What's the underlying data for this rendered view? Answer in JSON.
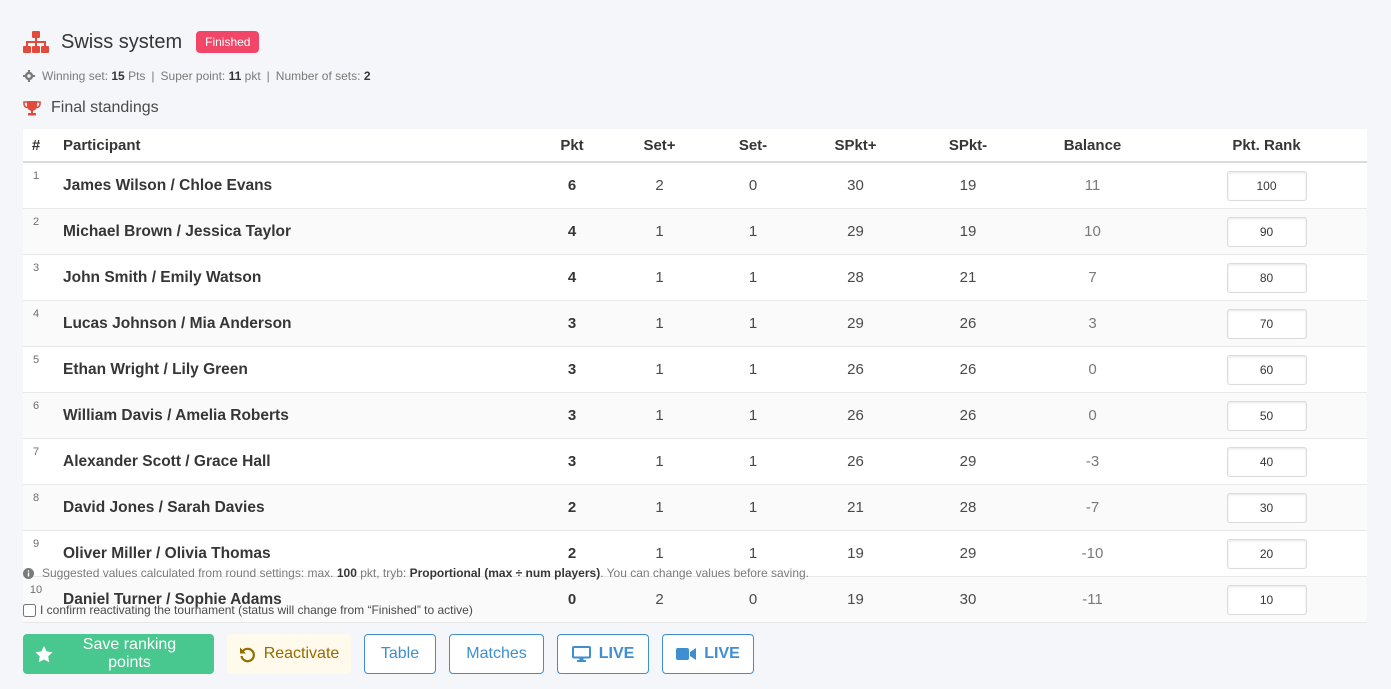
{
  "header": {
    "title": "Swiss system",
    "status_badge": "Finished"
  },
  "settings": {
    "winning_set_label": "Winning set:",
    "winning_set_value": "15",
    "winning_set_unit": "Pts",
    "super_point_label": "Super point:",
    "super_point_value": "11",
    "super_point_unit": "pkt",
    "num_sets_label": "Number of sets:",
    "num_sets_value": "2"
  },
  "standings": {
    "title": "Final standings",
    "columns": [
      "#",
      "Participant",
      "Pkt",
      "Set+",
      "Set-",
      "SPkt+",
      "SPkt-",
      "Balance",
      "Pkt. Rank"
    ],
    "rows": [
      {
        "idx": "1",
        "participant": "James Wilson / Chloe Evans",
        "pkt": "6",
        "set_plus": "2",
        "set_minus": "0",
        "spkt_plus": "30",
        "spkt_minus": "19",
        "balance": "11",
        "rank": "100"
      },
      {
        "idx": "2",
        "participant": "Michael Brown / Jessica Taylor",
        "pkt": "4",
        "set_plus": "1",
        "set_minus": "1",
        "spkt_plus": "29",
        "spkt_minus": "19",
        "balance": "10",
        "rank": "90"
      },
      {
        "idx": "3",
        "participant": "John Smith / Emily Watson",
        "pkt": "4",
        "set_plus": "1",
        "set_minus": "1",
        "spkt_plus": "28",
        "spkt_minus": "21",
        "balance": "7",
        "rank": "80"
      },
      {
        "idx": "4",
        "participant": "Lucas Johnson / Mia Anderson",
        "pkt": "3",
        "set_plus": "1",
        "set_minus": "1",
        "spkt_plus": "29",
        "spkt_minus": "26",
        "balance": "3",
        "rank": "70"
      },
      {
        "idx": "5",
        "participant": "Ethan Wright / Lily Green",
        "pkt": "3",
        "set_plus": "1",
        "set_minus": "1",
        "spkt_plus": "26",
        "spkt_minus": "26",
        "balance": "0",
        "rank": "60"
      },
      {
        "idx": "6",
        "participant": "William Davis / Amelia Roberts",
        "pkt": "3",
        "set_plus": "1",
        "set_minus": "1",
        "spkt_plus": "26",
        "spkt_minus": "26",
        "balance": "0",
        "rank": "50"
      },
      {
        "idx": "7",
        "participant": "Alexander Scott / Grace Hall",
        "pkt": "3",
        "set_plus": "1",
        "set_minus": "1",
        "spkt_plus": "26",
        "spkt_minus": "29",
        "balance": "-3",
        "rank": "40"
      },
      {
        "idx": "8",
        "participant": "David Jones / Sarah Davies",
        "pkt": "2",
        "set_plus": "1",
        "set_minus": "1",
        "spkt_plus": "21",
        "spkt_minus": "28",
        "balance": "-7",
        "rank": "30"
      },
      {
        "idx": "9",
        "participant": "Oliver Miller / Olivia Thomas",
        "pkt": "2",
        "set_plus": "1",
        "set_minus": "1",
        "spkt_plus": "19",
        "spkt_minus": "29",
        "balance": "-10",
        "rank": "20"
      },
      {
        "idx": "10",
        "participant": "Daniel Turner / Sophie Adams",
        "pkt": "0",
        "set_plus": "2",
        "set_minus": "0",
        "spkt_plus": "19",
        "spkt_minus": "30",
        "balance": "-11",
        "rank": "10"
      }
    ]
  },
  "note": {
    "text1": "Suggested values calculated from round settings: max. ",
    "max_value": "100",
    "text2": " pkt, tryb: ",
    "mode": "Proportional (max ÷ num players)",
    "text3": ". You can change values before saving."
  },
  "confirm_label": "I confirm reactivating the tournament (status will change from “Finished” to active)",
  "actions": {
    "save": "Save ranking points",
    "reactivate": "Reactivate",
    "table": "Table",
    "matches": "Matches",
    "live_screen": "LIVE",
    "live_video": "LIVE"
  },
  "icons": {
    "header": "sitemap-icon",
    "settings": "gear-icon",
    "standings": "trophy-icon",
    "note": "info-circle-icon",
    "save": "star-icon",
    "reactivate": "undo-icon",
    "live_screen": "desktop-icon",
    "live_video": "video-camera-icon"
  },
  "colors": {
    "brand_red": "#e24b3b",
    "badge": "#f14668",
    "save": "#48c78e",
    "reactivate_bg": "#fffaeb",
    "reactivate_text": "#946c00",
    "link_blue": "#3e8ed0"
  }
}
